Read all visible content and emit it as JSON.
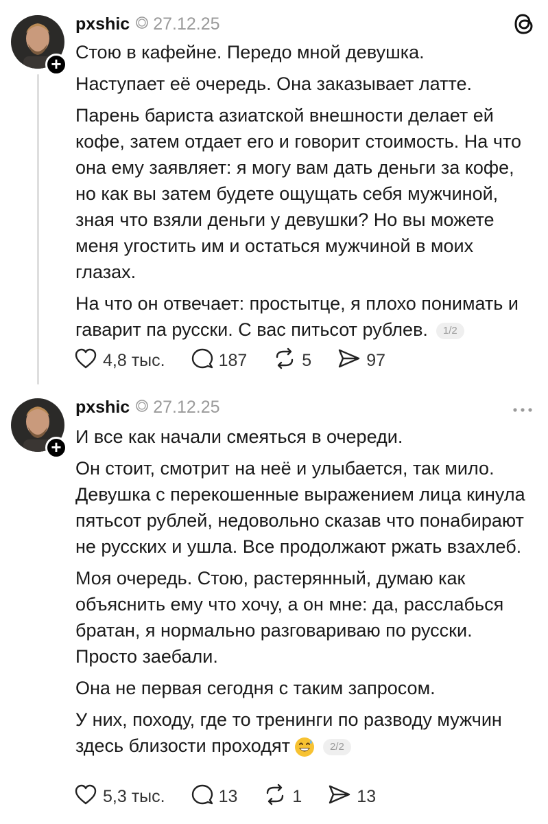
{
  "posts": [
    {
      "username": "pxshic",
      "date": "27.12.25",
      "paragraphs": [
        "Стою в кафейне. Передо мной девушка.",
        "Наступает её очередь. Она заказывает латте.",
        "Парень бариста азиатской внешности делает ей кофе, затем отдает его и говорит стоимость. На что она ему заявляет: я могу вам дать деньги за кофе, но как вы затем будете ощущать себя мужчиной, зная что взяли деньги у девушки? Но вы можете меня угостить им и остаться мужчиной в моих глазах.",
        "На что он отвечает: простытце, я плохо понимать и гаварит па русски. С вас питьсот рублев."
      ],
      "page_indicator": "1/2",
      "likes": "4,8 тыс.",
      "replies": "187",
      "reposts": "5",
      "shares": "97"
    },
    {
      "username": "pxshic",
      "date": "27.12.25",
      "paragraphs": [
        "И все как начали смеяться в очереди.",
        "Он стоит, смотрит на неё и улыбается, так мило. Девушка с перекошенные выражением лица кинула пятьсот рублей, недовольно сказав что понабирают не русских и ушла. Все продолжают ржать взахлеб.",
        "Моя очередь. Стою, растерянный, думаю как объяснить ему что хочу, а он мне: да, расслабься братан, я нормально разговариваю по русски. Просто заебали.",
        "Она не первая сегодня с таким запросом.",
        "У них, походу, где то тренинги по разводу мужчин здесь близости проходят"
      ],
      "page_indicator": "2/2",
      "likes": "5,3 тыс.",
      "replies": "13",
      "reposts": "1",
      "shares": "13"
    }
  ],
  "icons": {
    "app_logo": "threads-icon",
    "more": "more-horizontal-icon",
    "like": "heart-icon",
    "reply": "comment-icon",
    "repost": "repost-icon",
    "share": "send-icon",
    "verified": "verified-icon",
    "follow": "plus-icon",
    "emoji": "grinning-sweat-emoji"
  },
  "colors": {
    "text": "#1a1a1a",
    "muted": "#9a9a9a",
    "divider": "#dedede",
    "background": "#ffffff"
  }
}
